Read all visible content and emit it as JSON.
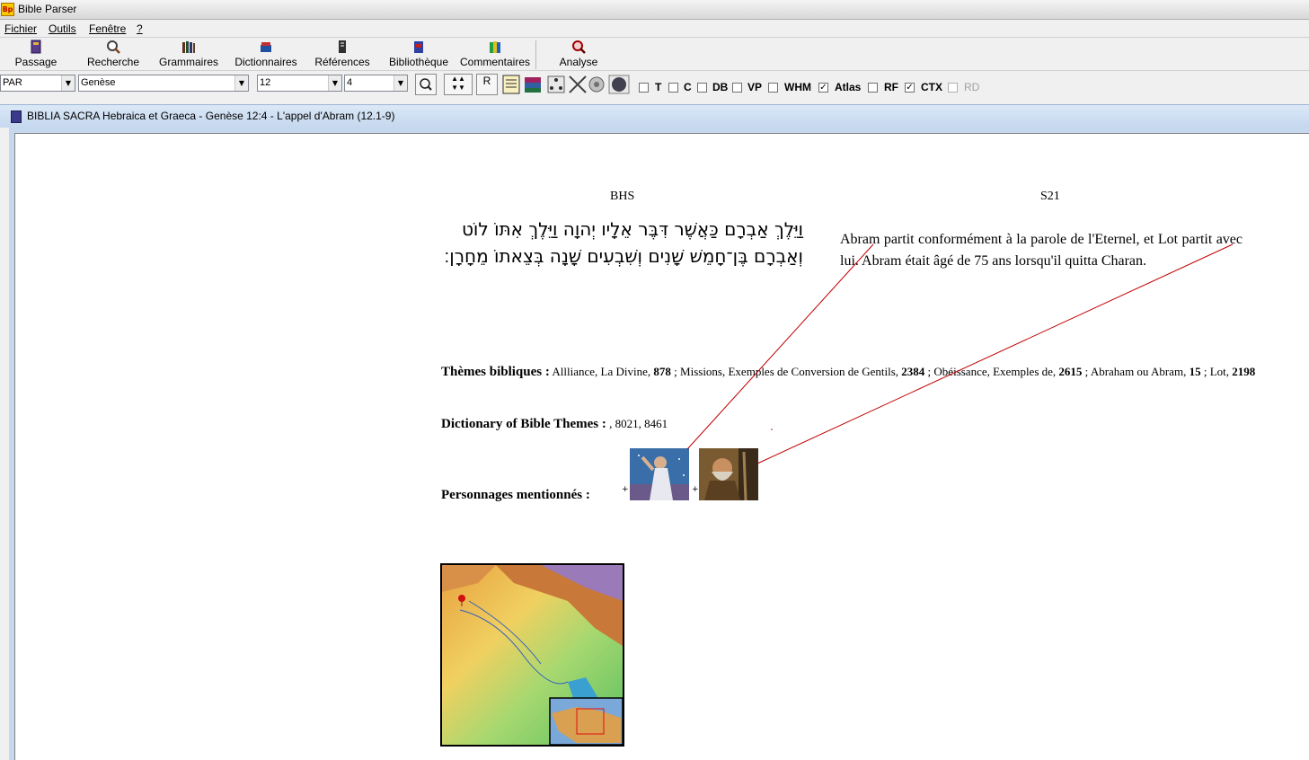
{
  "window": {
    "title": "Bible Parser",
    "icon": "bp-app-icon"
  },
  "menu": {
    "items": [
      "Fichier",
      "Outils",
      "Fenêtre",
      "?"
    ]
  },
  "toolbar": {
    "buttons": [
      {
        "label": "Passage",
        "icon": "book-icon"
      },
      {
        "label": "Recherche",
        "icon": "search-icon"
      },
      {
        "label": "Grammaires",
        "icon": "grammar-books-icon"
      },
      {
        "label": "Dictionnaires",
        "icon": "dictionary-icon"
      },
      {
        "label": "Références",
        "icon": "references-icon"
      },
      {
        "label": "Bibliothèque",
        "icon": "library-icon"
      },
      {
        "label": "Commentaires",
        "icon": "commentary-icon"
      },
      {
        "label": "Analyse",
        "icon": "analysis-icon"
      }
    ]
  },
  "controls": {
    "version": "PAR",
    "book": "Genèse",
    "chapter": "12",
    "verse": "4",
    "r_button": "R",
    "options": [
      {
        "label": "T",
        "checked": false,
        "enabled": true
      },
      {
        "label": "C",
        "checked": false,
        "enabled": true
      },
      {
        "label": "DB",
        "checked": false,
        "enabled": true
      },
      {
        "label": "VP",
        "checked": false,
        "enabled": true
      },
      {
        "label": "WHM",
        "checked": false,
        "enabled": true
      },
      {
        "label": "Atlas",
        "checked": true,
        "enabled": true
      },
      {
        "label": "RF",
        "checked": false,
        "enabled": true
      },
      {
        "label": "CTX",
        "checked": true,
        "enabled": true
      },
      {
        "label": "RD",
        "checked": false,
        "enabled": false
      }
    ]
  },
  "document": {
    "window_title": "BIBLIA SACRA Hebraica et Graeca - Genèse 12:4 - L'appel d'Abram (12.1-9)",
    "col_left": "BHS",
    "col_right": "S21",
    "hebrew_text": "וַיֵּלֶךְ אַבְרָם כַּאֲשֶׁר דִּבֶּר אֵלָיו יְהוָה וַיֵּלֶךְ אִתּוֹ לוֹט וְאַבְרָם בֶּן־חָמֵשׁ שָׁנִים וְשִׁבְעִים שָׁנָה בְּצֵאתוֹ מֵחָרָן׃",
    "french_text": "Abram partit conformément à la parole de l'Eternel, et Lot partit avec lui. Abram était âgé de 75 ans lorsqu'il quitta Charan.",
    "themes_label": "Thèmes bibliques :",
    "themes": [
      {
        "text": "Allliance, La Divine,",
        "num": "878"
      },
      {
        "text": "Missions, Exemples de Conversion de Gentils,",
        "num": "2384"
      },
      {
        "text": "Obéissance, Exemples de,",
        "num": "2615"
      },
      {
        "text": "Abraham ou Abram,",
        "num": "15"
      },
      {
        "text": "Lot,",
        "num": "2198"
      }
    ],
    "dict_label": "Dictionary of Bible Themes :",
    "dict_values": ", 8021, 8461",
    "persons_label": "Personnages mentionnés :",
    "plus": "+"
  }
}
